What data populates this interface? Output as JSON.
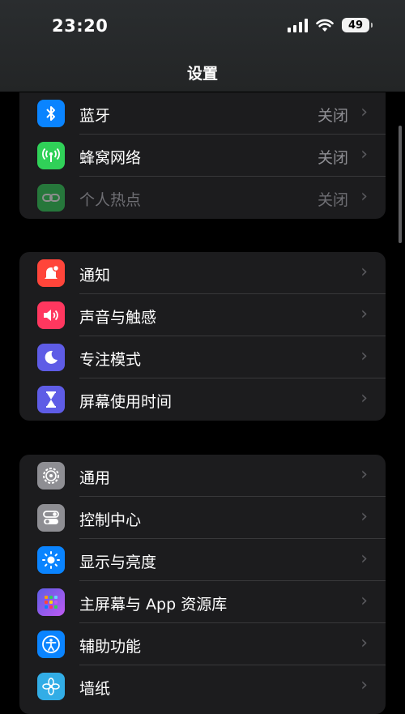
{
  "status": {
    "time": "23:20",
    "battery": "49"
  },
  "nav": {
    "title": "设置"
  },
  "groups": [
    {
      "items": [
        {
          "label": "蓝牙",
          "value": "关闭",
          "icon": "bluetooth-icon",
          "color": "#0a84ff"
        },
        {
          "label": "蜂窝网络",
          "value": "关闭",
          "icon": "cellular-icon",
          "color": "#30d158"
        },
        {
          "label": "个人热点",
          "value": "关闭",
          "icon": "hotspot-icon",
          "color": "#30d158"
        }
      ]
    },
    {
      "items": [
        {
          "label": "通知",
          "icon": "notification-bell-icon",
          "color": "#ff453a"
        },
        {
          "label": "声音与触感",
          "icon": "speaker-icon",
          "color": "#ff375f"
        },
        {
          "label": "专注模式",
          "icon": "moon-icon",
          "color": "#5e5ce6"
        },
        {
          "label": "屏幕使用时间",
          "icon": "hourglass-icon",
          "color": "#5e5ce6"
        }
      ]
    },
    {
      "items": [
        {
          "label": "通用",
          "icon": "gear-icon",
          "color": "#8e8e93"
        },
        {
          "label": "控制中心",
          "icon": "toggles-icon",
          "color": "#8e8e93"
        },
        {
          "label": "显示与亮度",
          "icon": "brightness-icon",
          "color": "#0a84ff"
        },
        {
          "label": "主屏幕与 App 资源库",
          "icon": "app-grid-icon",
          "color": "#5e5ce6"
        },
        {
          "label": "辅助功能",
          "icon": "accessibility-icon",
          "color": "#0a84ff"
        },
        {
          "label": "墙纸",
          "icon": "wallpaper-flower-icon",
          "color": "#32ade6"
        }
      ]
    }
  ]
}
